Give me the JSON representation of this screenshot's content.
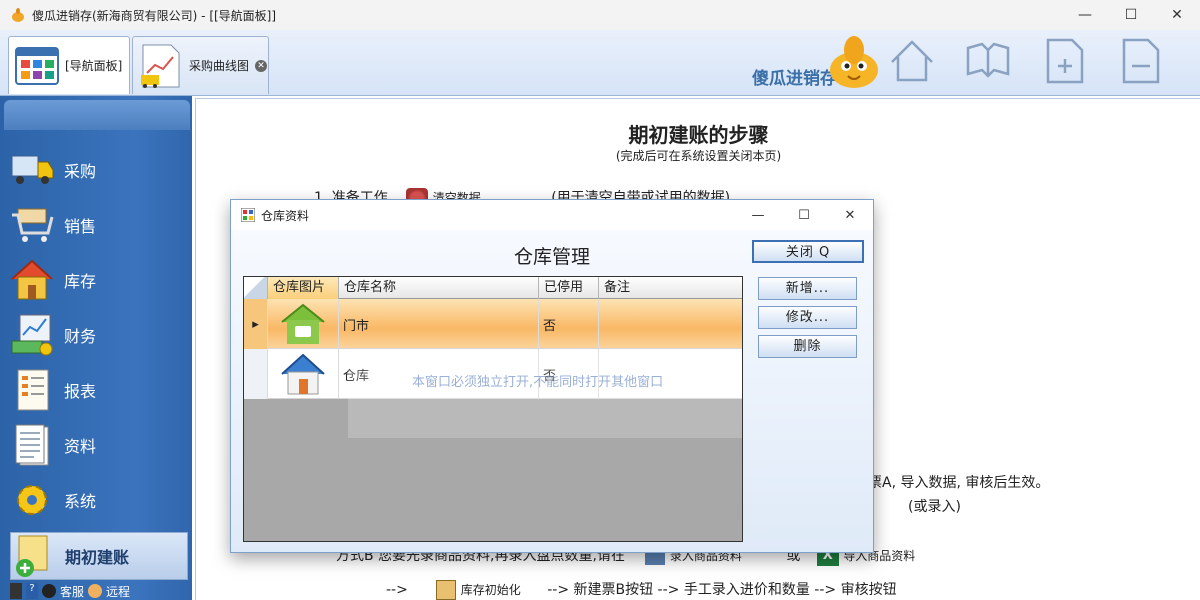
{
  "window": {
    "title": "傻瓜进销存(新海商贸有限公司) - [[导航面板]]",
    "min": "—",
    "max": "☐",
    "close": "✕"
  },
  "tabs": [
    {
      "label": "[导航面板]"
    },
    {
      "label": "采购曲线图"
    }
  ],
  "brand": "傻瓜进销存",
  "sidebar": {
    "items": [
      {
        "label": "采购",
        "icon": "truck-icon"
      },
      {
        "label": "销售",
        "icon": "cart-icon"
      },
      {
        "label": "库存",
        "icon": "house-icon"
      },
      {
        "label": "财务",
        "icon": "money-chart-icon"
      },
      {
        "label": "报表",
        "icon": "report-icon"
      },
      {
        "label": "资料",
        "icon": "document-icon"
      },
      {
        "label": "系统",
        "icon": "gear-icon"
      }
    ],
    "setup": {
      "label": "期初建账"
    },
    "bottom": {
      "service": "客服",
      "remote": "远程"
    }
  },
  "main": {
    "title": "期初建账的步骤",
    "subtitle": "(完成后可在系统设置关闭本页)",
    "step1_prefix": "1. 准备工作",
    "step1_button": "清空数据",
    "step1_note": "(用于清空自带或试用的数据)",
    "line_a": "票A, 导入数据, 审核后生效。",
    "line_a_sub": "(或录入)",
    "line_b": "方式B 您要先录商品资料,再录入盘点数量,请在",
    "line_b_btn1": "录入商品资料",
    "line_b_or": "或",
    "line_b_btn2": "导入商品资料",
    "line_c_arrow": "-->",
    "line_c_btn": "库存初始化",
    "line_c_rest": "--> 新建票B按钮 --> 手工录入进价和数量 --> 审核按钮"
  },
  "dialog": {
    "title": "仓库资料",
    "heading": "仓库管理",
    "close_button": "关闭 Q",
    "add_button": "新增...",
    "edit_button": "修改...",
    "delete_button": "删除",
    "columns": [
      "仓库图片",
      "仓库名称",
      "已停用",
      "备注"
    ],
    "rows": [
      {
        "name": "门市",
        "disabled": "否",
        "note": ""
      },
      {
        "name": "仓库",
        "disabled": "否",
        "note": ""
      }
    ],
    "watermark": "本窗口必须独立打开,不能同时打开其他窗口"
  }
}
